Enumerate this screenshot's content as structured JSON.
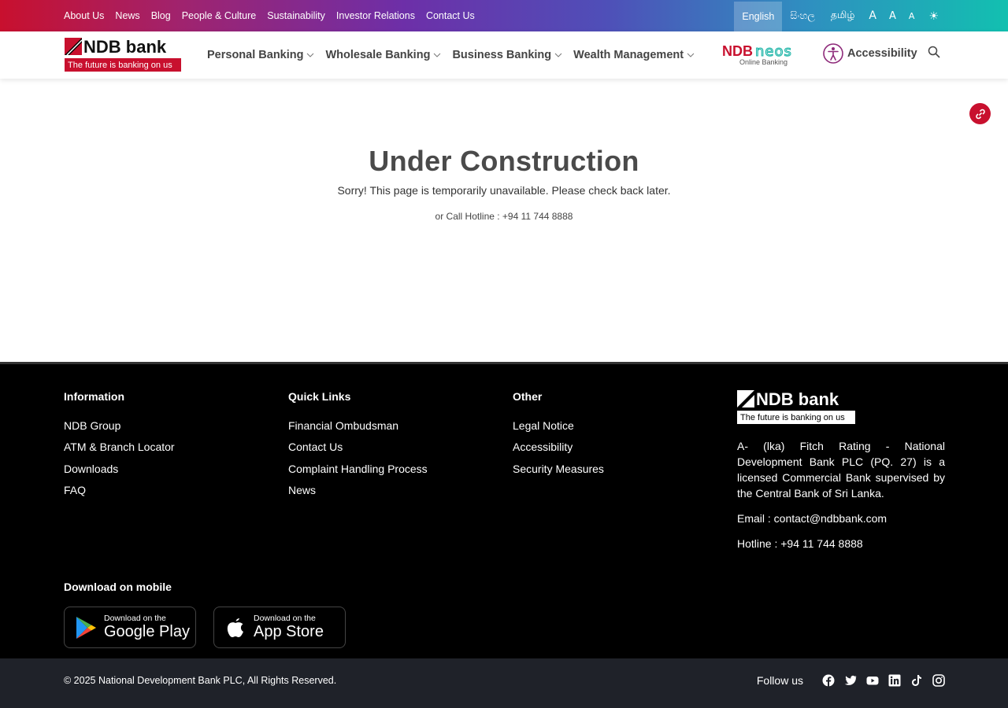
{
  "topbar": {
    "links": [
      "About Us",
      "News",
      "Blog",
      "People & Culture",
      "Sustainability",
      "Investor Relations",
      "Contact Us"
    ],
    "languages": {
      "english": "English",
      "sinhala": "සිංහල",
      "tamil": "தமிழ்"
    },
    "font_sizes": {
      "large": "A",
      "medium": "A",
      "small": "A"
    },
    "theme_icon": "sun-icon"
  },
  "header": {
    "logo": {
      "brand": "NDB bank",
      "tagline": "The future is banking on us"
    },
    "nav": [
      "Personal Banking",
      "Wholesale Banking",
      "Business Banking",
      "Wealth Management"
    ],
    "neos": {
      "brand": "NDBneos",
      "tagline": "Online Banking"
    },
    "accessibility_label": "Accessibility"
  },
  "main": {
    "title": "Under Construction",
    "message": "Sorry! This page is temporarily unavailable. Please check back later.",
    "hotline": "or Call Hotline : +94 11 744 8888"
  },
  "footer": {
    "information": {
      "heading": "Information",
      "links": [
        "NDB Group",
        "ATM & Branch Locator",
        "Downloads",
        "FAQ"
      ]
    },
    "quick_links": {
      "heading": "Quick Links",
      "links": [
        "Financial Ombudsman",
        "Contact Us",
        "Complaint Handling Process",
        "News"
      ]
    },
    "other": {
      "heading": "Other",
      "links": [
        "Legal Notice",
        "Accessibility",
        "Security Measures"
      ]
    },
    "about": {
      "logo_brand": "NDB bank",
      "logo_tagline": "The future is banking on us",
      "rating": "A- (lka) Fitch Rating - National Development Bank PLC (PQ. 27) is a licensed Commercial Bank supervised by the Central Bank of Sri Lanka.",
      "email": "Email : contact@ndbbank.com",
      "hotline": "Hotline : +94 11 744 8888"
    },
    "download": {
      "heading": "Download on mobile",
      "google_play": {
        "small": "Download on the",
        "big": "Google Play"
      },
      "app_store": {
        "small": "Download on the",
        "big": "App Store"
      }
    },
    "copyright": "© 2025 National Development Bank PLC, All Rights Reserved.",
    "follow_label": "Follow us",
    "social_icons": [
      "facebook-icon",
      "twitter-icon",
      "youtube-icon",
      "linkedin-icon",
      "tiktok-icon",
      "instagram-icon"
    ]
  },
  "colors": {
    "brand_red": "#c8102e",
    "footer_bg": "#000000",
    "bottom_bar": "#1f2229",
    "neos_teal": "#1fb5a8"
  }
}
